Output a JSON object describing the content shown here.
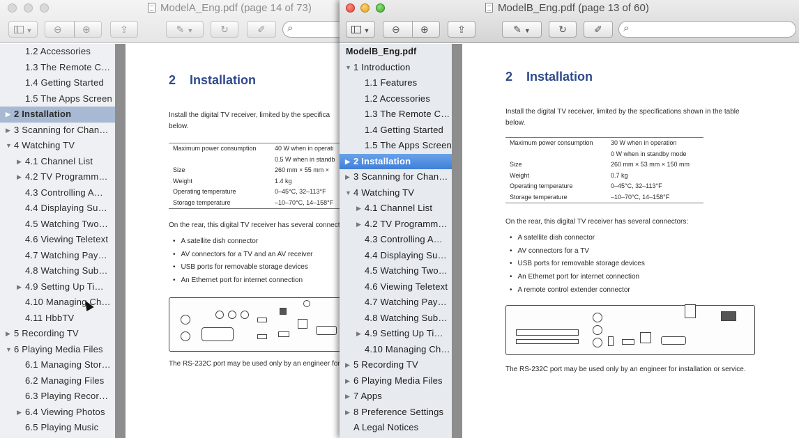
{
  "window_a": {
    "title": "ModelA_Eng.pdf (page 14 of 73)",
    "sidebar": [
      {
        "label": "1.2 Accessories",
        "indent": 2,
        "arrow": "",
        "selected": false
      },
      {
        "label": "1.3 The Remote C…",
        "indent": 2,
        "arrow": "",
        "selected": false
      },
      {
        "label": "1.4 Getting Started",
        "indent": 2,
        "arrow": "",
        "selected": false
      },
      {
        "label": "1.5 The Apps Screen",
        "indent": 2,
        "arrow": "",
        "selected": false
      },
      {
        "label": "2 Installation",
        "indent": 1,
        "arrow": "▶",
        "selected": true
      },
      {
        "label": "3 Scanning for Chan…",
        "indent": 1,
        "arrow": "▶",
        "selected": false
      },
      {
        "label": "4 Watching TV",
        "indent": 1,
        "arrow": "▼",
        "selected": false
      },
      {
        "label": "4.1 Channel List",
        "indent": 2,
        "arrow": "▶",
        "selected": false
      },
      {
        "label": "4.2 TV Programm…",
        "indent": 2,
        "arrow": "▶",
        "selected": false
      },
      {
        "label": "4.3 Controlling A…",
        "indent": 2,
        "arrow": "",
        "selected": false
      },
      {
        "label": "4.4 Displaying Su…",
        "indent": 2,
        "arrow": "",
        "selected": false
      },
      {
        "label": "4.5 Watching Two…",
        "indent": 2,
        "arrow": "",
        "selected": false
      },
      {
        "label": "4.6 Viewing Teletext",
        "indent": 2,
        "arrow": "",
        "selected": false
      },
      {
        "label": "4.7 Watching Pay…",
        "indent": 2,
        "arrow": "",
        "selected": false
      },
      {
        "label": "4.8 Watching Sub…",
        "indent": 2,
        "arrow": "",
        "selected": false
      },
      {
        "label": "4.9 Setting Up Ti…",
        "indent": 2,
        "arrow": "▶",
        "selected": false
      },
      {
        "label": "4.10 Managing Ch…",
        "indent": 2,
        "arrow": "",
        "selected": false
      },
      {
        "label": "4.11 HbbTV",
        "indent": 2,
        "arrow": "",
        "selected": false
      },
      {
        "label": "5 Recording TV",
        "indent": 1,
        "arrow": "▶",
        "selected": false
      },
      {
        "label": "6 Playing Media Files",
        "indent": 1,
        "arrow": "▼",
        "selected": false
      },
      {
        "label": "6.1 Managing Stor…",
        "indent": 2,
        "arrow": "",
        "selected": false
      },
      {
        "label": "6.2 Managing Files",
        "indent": 2,
        "arrow": "",
        "selected": false
      },
      {
        "label": "6.3 Playing Recor…",
        "indent": 2,
        "arrow": "",
        "selected": false
      },
      {
        "label": "6.4 Viewing Photos",
        "indent": 2,
        "arrow": "▶",
        "selected": false
      },
      {
        "label": "6.5 Playing Music",
        "indent": 2,
        "arrow": "",
        "selected": false
      }
    ],
    "page": {
      "heading_num": "2",
      "heading": "Installation",
      "intro_line1": "Install the digital TV receiver, limited by the specifica",
      "intro_line2": "below.",
      "specs": [
        {
          "k": "Maximum power consumption",
          "v": "40 W when in operati"
        },
        {
          "k": "",
          "v": "0.5 W when in standb"
        },
        {
          "k": "Size",
          "v": "260 mm × 55 mm ×"
        },
        {
          "k": "Weight",
          "v": "1.4 kg"
        },
        {
          "k": "Operating temperature",
          "v": "0–45°C, 32–113°F"
        },
        {
          "k": "Storage temperature",
          "v": "–10–70°C, 14–158°F"
        }
      ],
      "rear_text": "On the rear, this digital TV receiver has several connect",
      "bullets": [
        "A satellite dish connector",
        "AV connectors for a TV and an AV receiver",
        "USB ports for removable storage devices",
        "An Ethernet port for internet connection"
      ],
      "rs_note": "The RS-232C port may be used only by an engineer for"
    }
  },
  "window_b": {
    "title": "ModelB_Eng.pdf (page 13 of 60)",
    "sidebar_header": "ModelB_Eng.pdf",
    "sidebar": [
      {
        "label": "1 Introduction",
        "indent": 1,
        "arrow": "▼",
        "selected": false
      },
      {
        "label": "1.1 Features",
        "indent": 2,
        "arrow": "",
        "selected": false
      },
      {
        "label": "1.2 Accessories",
        "indent": 2,
        "arrow": "",
        "selected": false
      },
      {
        "label": "1.3 The Remote C…",
        "indent": 2,
        "arrow": "",
        "selected": false
      },
      {
        "label": "1.4 Getting Started",
        "indent": 2,
        "arrow": "",
        "selected": false
      },
      {
        "label": "1.5 The Apps Screen",
        "indent": 2,
        "arrow": "",
        "selected": false
      },
      {
        "label": "2 Installation",
        "indent": 1,
        "arrow": "▶",
        "selected": true
      },
      {
        "label": "3 Scanning for Chan…",
        "indent": 1,
        "arrow": "▶",
        "selected": false
      },
      {
        "label": "4 Watching TV",
        "indent": 1,
        "arrow": "▼",
        "selected": false
      },
      {
        "label": "4.1 Channel List",
        "indent": 2,
        "arrow": "▶",
        "selected": false
      },
      {
        "label": "4.2 TV Programm…",
        "indent": 2,
        "arrow": "▶",
        "selected": false
      },
      {
        "label": "4.3 Controlling A…",
        "indent": 2,
        "arrow": "",
        "selected": false
      },
      {
        "label": "4.4 Displaying Su…",
        "indent": 2,
        "arrow": "",
        "selected": false
      },
      {
        "label": "4.5 Watching Two…",
        "indent": 2,
        "arrow": "",
        "selected": false
      },
      {
        "label": "4.6 Viewing Teletext",
        "indent": 2,
        "arrow": "",
        "selected": false
      },
      {
        "label": "4.7 Watching Pay…",
        "indent": 2,
        "arrow": "",
        "selected": false
      },
      {
        "label": "4.8 Watching Sub…",
        "indent": 2,
        "arrow": "",
        "selected": false
      },
      {
        "label": "4.9 Setting Up Ti…",
        "indent": 2,
        "arrow": "▶",
        "selected": false
      },
      {
        "label": "4.10 Managing Ch…",
        "indent": 2,
        "arrow": "",
        "selected": false
      },
      {
        "label": "5 Recording TV",
        "indent": 1,
        "arrow": "▶",
        "selected": false
      },
      {
        "label": "6 Playing Media Files",
        "indent": 1,
        "arrow": "▶",
        "selected": false
      },
      {
        "label": "7 Apps",
        "indent": 1,
        "arrow": "▶",
        "selected": false
      },
      {
        "label": "8 Preference Settings",
        "indent": 1,
        "arrow": "▶",
        "selected": false
      },
      {
        "label": "A Legal Notices",
        "indent": 1,
        "arrow": "",
        "selected": false
      }
    ],
    "page": {
      "heading_num": "2",
      "heading": "Installation",
      "intro_line1": "Install the digital TV receiver, limited by the specifications shown in the table",
      "intro_line2": "below.",
      "specs": [
        {
          "k": "Maximum power consumption",
          "v": "30 W when in operation"
        },
        {
          "k": "",
          "v": "0 W when in standby mode"
        },
        {
          "k": "Size",
          "v": "260 mm × 53 mm × 150 mm"
        },
        {
          "k": "Weight",
          "v": "0.7 kg"
        },
        {
          "k": "Operating temperature",
          "v": "0–45°C, 32–113°F"
        },
        {
          "k": "Storage temperature",
          "v": "–10–70°C, 14–158°F"
        }
      ],
      "rear_text": "On the rear, this digital TV receiver has several connectors:",
      "bullets": [
        "A satellite dish connector",
        "AV connectors for a TV",
        "USB ports for removable storage devices",
        "An Ethernet port for internet connection",
        "A remote control extender connector"
      ],
      "rs_note": "The RS-232C port may be used only by an engineer for installation or service."
    }
  },
  "toolbar": {
    "sidebar_icon": "sidebar-toggle-icon",
    "zoom_out_icon": "zoom-out-icon",
    "zoom_in_icon": "zoom-in-icon",
    "share_icon": "share-icon",
    "annotate_icon": "annotate-pen-icon",
    "rotate_icon": "rotate-icon",
    "edit_icon": "edit-toolbox-icon",
    "search_icon": "search-icon"
  }
}
